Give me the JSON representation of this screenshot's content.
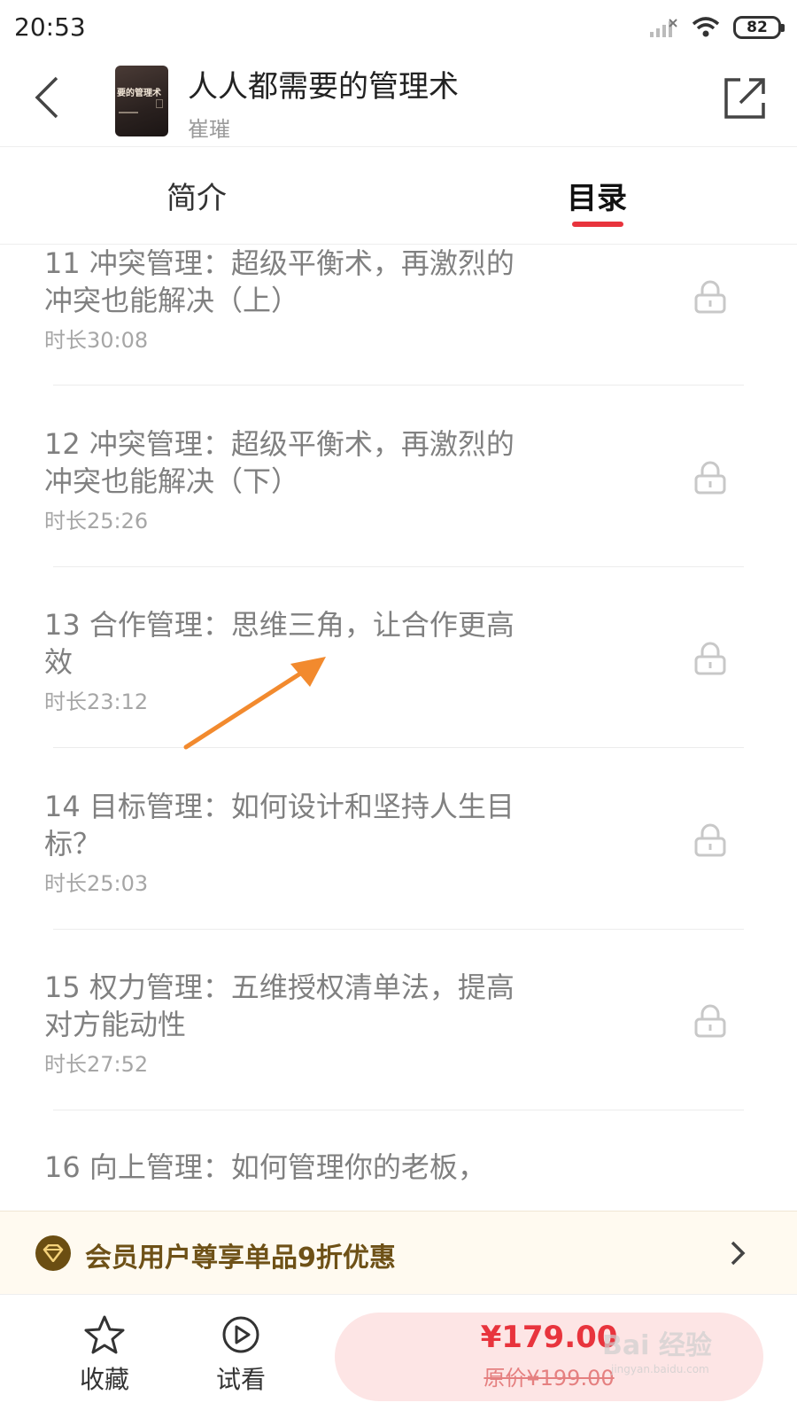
{
  "status_bar": {
    "time": "20:53",
    "battery": "82"
  },
  "header": {
    "title": "人人都需要的管理术",
    "author": "崔璀",
    "cover_text": "要的管理术"
  },
  "tabs": [
    {
      "label": "简介",
      "active": false
    },
    {
      "label": "目录",
      "active": true
    }
  ],
  "chapters": [
    {
      "title": "11 冲突管理：超级平衡术，再激烈的冲突也能解决（上）",
      "duration": "时长30:08",
      "locked": true
    },
    {
      "title": "12 冲突管理：超级平衡术，再激烈的冲突也能解决（下）",
      "duration": "时长25:26",
      "locked": true
    },
    {
      "title": "13 合作管理：思维三角，让合作更高效",
      "duration": "时长23:12",
      "locked": true
    },
    {
      "title": "14 目标管理：如何设计和坚持人生目标？",
      "duration": "时长25:03",
      "locked": true
    },
    {
      "title": "15 权力管理：五维授权清单法，提高对方能动性",
      "duration": "时长27:52",
      "locked": true
    },
    {
      "title": "16 向上管理：如何管理你的老板，",
      "duration": "",
      "locked": true
    }
  ],
  "member_banner": {
    "text": "会员用户尊享单品9折优惠"
  },
  "bottom_bar": {
    "favorite_label": "收藏",
    "trial_label": "试看",
    "price": "¥179.00",
    "original_price": "原价¥199.00"
  },
  "watermark": {
    "text": "Bai 经验",
    "sub": "jingyan.baidu.com"
  },
  "colors": {
    "accent": "#e8343d",
    "gold": "#6e5117",
    "arrow": "#f28a2e"
  }
}
